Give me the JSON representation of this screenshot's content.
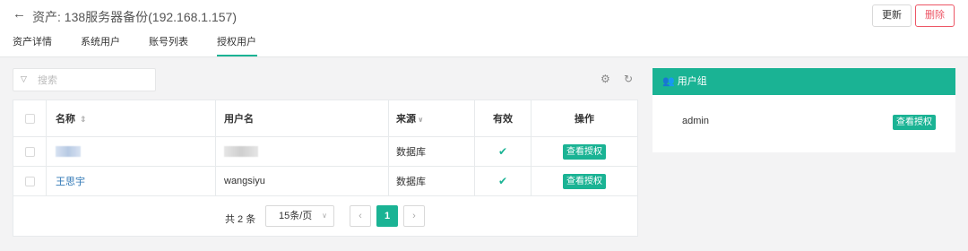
{
  "header": {
    "back_icon": "arrow-left-icon",
    "title": "资产: 138服务器备份(192.168.1.157)",
    "update_label": "更新",
    "delete_label": "删除"
  },
  "tabs": [
    {
      "label": "资产详情"
    },
    {
      "label": "系统用户"
    },
    {
      "label": "账号列表"
    },
    {
      "label": "授权用户",
      "active": true
    }
  ],
  "search": {
    "placeholder": "搜索",
    "value": ""
  },
  "toolbar": {
    "settings_icon": "gear-icon",
    "refresh_icon": "refresh-icon"
  },
  "table": {
    "columns": [
      "名称",
      "用户名",
      "来源",
      "有效",
      "操作"
    ],
    "rows": [
      {
        "name": "",
        "username": "",
        "source": "数据库",
        "valid": "✔",
        "action": "查看授权",
        "redacted": true
      },
      {
        "name": "王思宇",
        "username": "wangsiyu",
        "source": "数据库",
        "valid": "✔",
        "action": "查看授权"
      }
    ]
  },
  "pagination": {
    "total": "共 2 条",
    "page_size": "15条/页",
    "prev": "‹",
    "current": "1",
    "next": "›"
  },
  "user_group": {
    "title": "用户组",
    "icon": "users-icon",
    "items": [
      {
        "name": "admin",
        "action": "查看授权"
      }
    ]
  },
  "colors": {
    "accent": "#1ab394",
    "danger": "#ed5565",
    "link": "#337ab7"
  }
}
